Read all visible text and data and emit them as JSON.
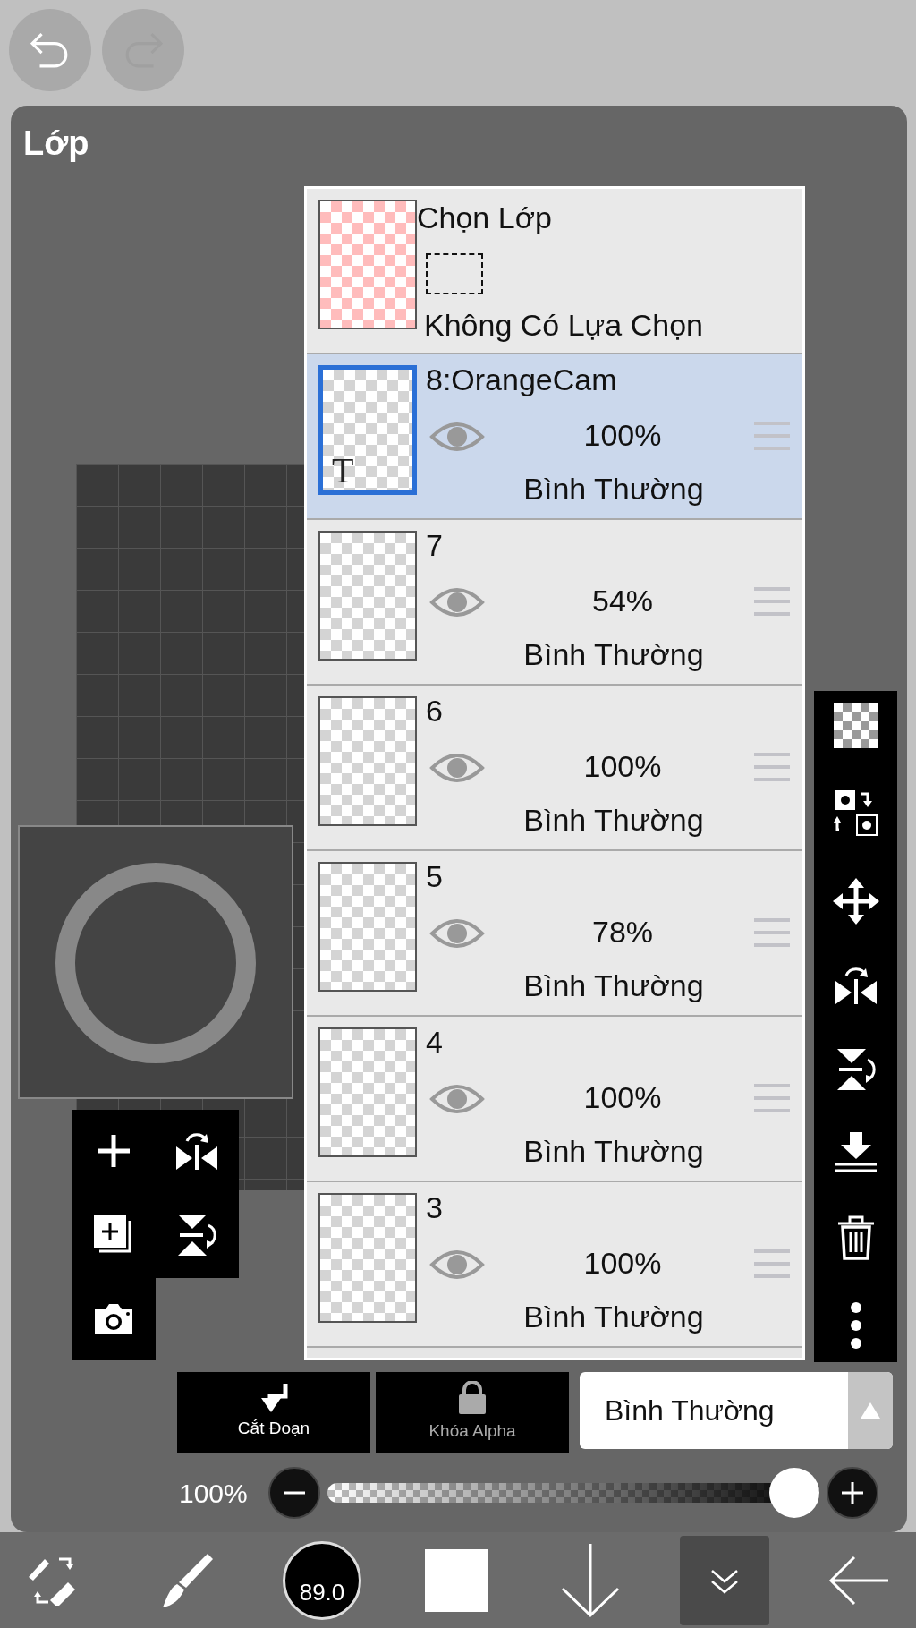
{
  "top_bar": {
    "buttons": [
      {
        "kind": "undo",
        "disabled": false
      },
      {
        "kind": "redo",
        "disabled": true
      }
    ]
  },
  "panel": {
    "title": "Lớp"
  },
  "selection_layer": {
    "title": "Chọn Lớp",
    "status": "Không Có Lựa Chọn"
  },
  "layers": [
    {
      "name": "8:OrangeCam",
      "opacity": "100%",
      "blend_mode": "Bình Thường",
      "selected": true,
      "visible": true,
      "kind": "text",
      "badge": "T"
    },
    {
      "name": "7",
      "opacity": "54%",
      "blend_mode": "Bình Thường",
      "selected": false,
      "visible": true,
      "kind": "raster"
    },
    {
      "name": "6",
      "opacity": "100%",
      "blend_mode": "Bình Thường",
      "selected": false,
      "visible": true,
      "kind": "raster"
    },
    {
      "name": "5",
      "opacity": "78%",
      "blend_mode": "Bình Thường",
      "selected": false,
      "visible": true,
      "kind": "raster"
    },
    {
      "name": "4",
      "opacity": "100%",
      "blend_mode": "Bình Thường",
      "selected": false,
      "visible": true,
      "kind": "raster"
    },
    {
      "name": "3",
      "opacity": "100%",
      "blend_mode": "Bình Thường",
      "selected": false,
      "visible": true,
      "kind": "raster"
    }
  ],
  "layer_actions": [
    {
      "label": "Cắt Đoạn",
      "kind": "clip",
      "disabled": false
    },
    {
      "label": "Khóa Alpha",
      "kind": "alpha-lock",
      "disabled": true
    }
  ],
  "blend_select": {
    "value": "Bình Thường"
  },
  "opacity": {
    "reading": "100%",
    "level": 1.0
  },
  "tools": [
    {
      "kind": "brush-eraser",
      "selected": false
    },
    {
      "kind": "brush",
      "selected": false
    },
    {
      "kind": "brush-size",
      "label": "89.0",
      "selected": false
    },
    {
      "kind": "color",
      "selected": false
    },
    {
      "kind": "arrow-down",
      "selected": false
    },
    {
      "kind": "layers",
      "selected": true
    },
    {
      "kind": "back",
      "selected": false
    }
  ]
}
